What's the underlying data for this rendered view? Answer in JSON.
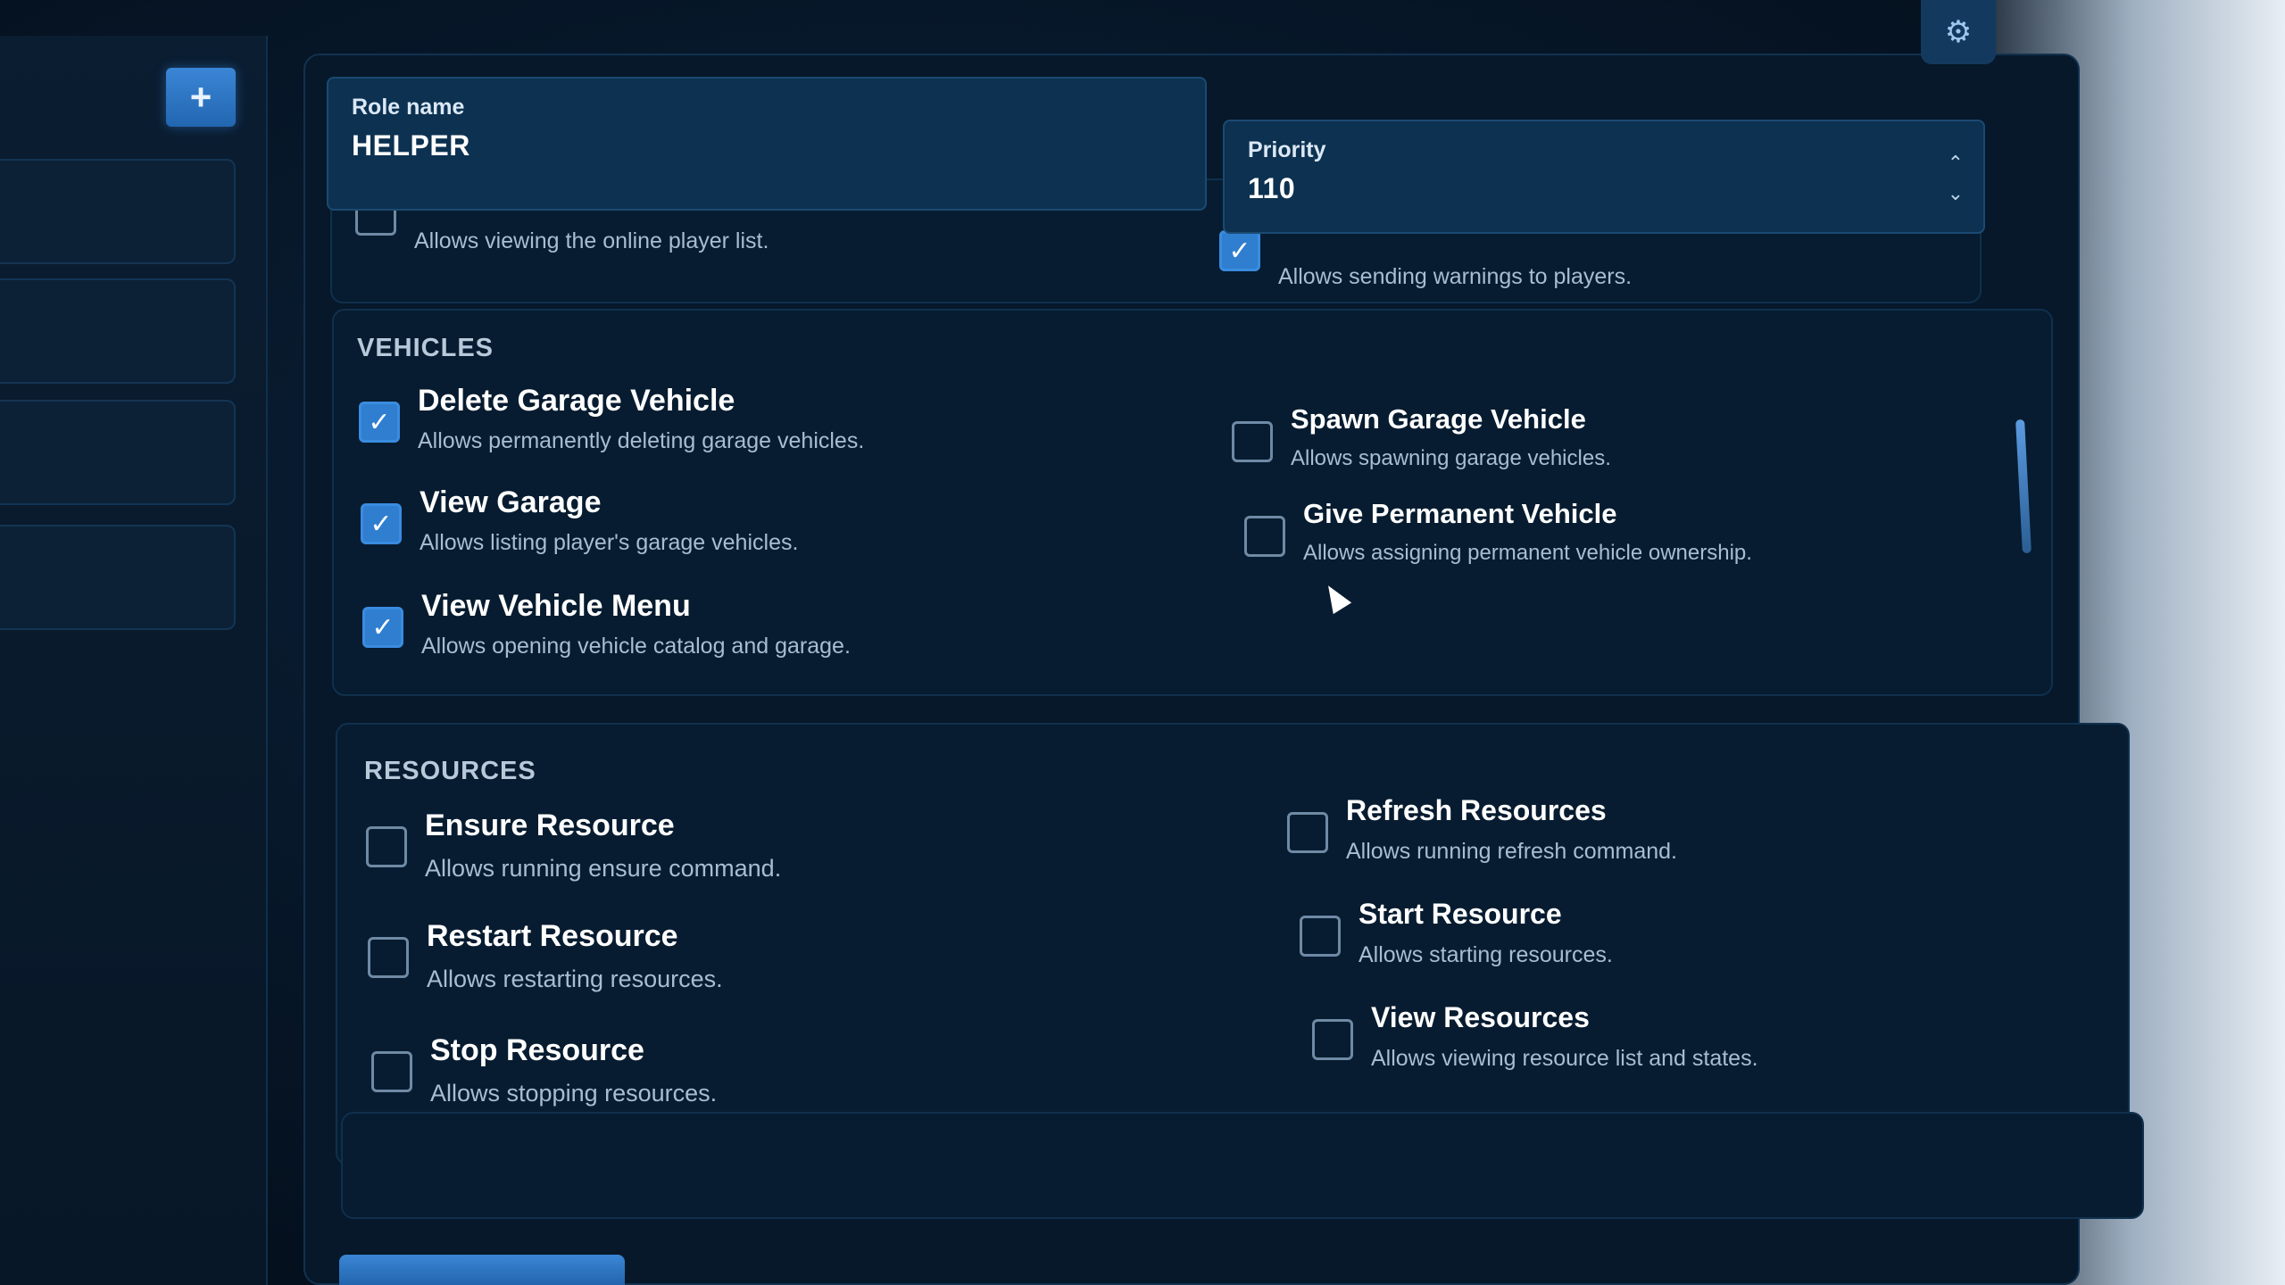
{
  "header": {
    "role_name_label": "Role name",
    "role_name_value": "HELPER",
    "priority_label": "Priority",
    "priority_value": "110",
    "stepper_up": "⌃",
    "stepper_down": "⌄"
  },
  "sidebar": {
    "add_label": "+"
  },
  "top_partial": {
    "left_desc": "Allows viewing the online player list.",
    "left_checked": false,
    "right_desc": "Allows sending warnings to players.",
    "right_checked": true
  },
  "vehicles": {
    "title": "VEHICLES",
    "items": [
      {
        "title": "Delete Garage Vehicle",
        "desc": "Allows permanently deleting garage vehicles.",
        "checked": true
      },
      {
        "title": "View Garage",
        "desc": "Allows listing player's garage vehicles.",
        "checked": true
      },
      {
        "title": "View Vehicle Menu",
        "desc": "Allows opening vehicle catalog and garage.",
        "checked": true
      },
      {
        "title": "Spawn Garage Vehicle",
        "desc": "Allows spawning garage vehicles.",
        "checked": false
      },
      {
        "title": "Give Permanent Vehicle",
        "desc": "Allows assigning permanent vehicle ownership.",
        "checked": false
      }
    ]
  },
  "resources": {
    "title": "RESOURCES",
    "items": [
      {
        "title": "Ensure Resource",
        "desc": "Allows running ensure command.",
        "checked": false
      },
      {
        "title": "Restart Resource",
        "desc": "Allows restarting resources.",
        "checked": false
      },
      {
        "title": "Stop Resource",
        "desc": "Allows stopping resources.",
        "checked": false
      },
      {
        "title": "Refresh Resources",
        "desc": "Allows running refresh command.",
        "checked": false
      },
      {
        "title": "Start Resource",
        "desc": "Allows starting resources.",
        "checked": false
      },
      {
        "title": "View Resources",
        "desc": "Allows viewing resource list and states.",
        "checked": false
      }
    ]
  },
  "icons": {
    "check": "✓",
    "gear": "⚙"
  }
}
